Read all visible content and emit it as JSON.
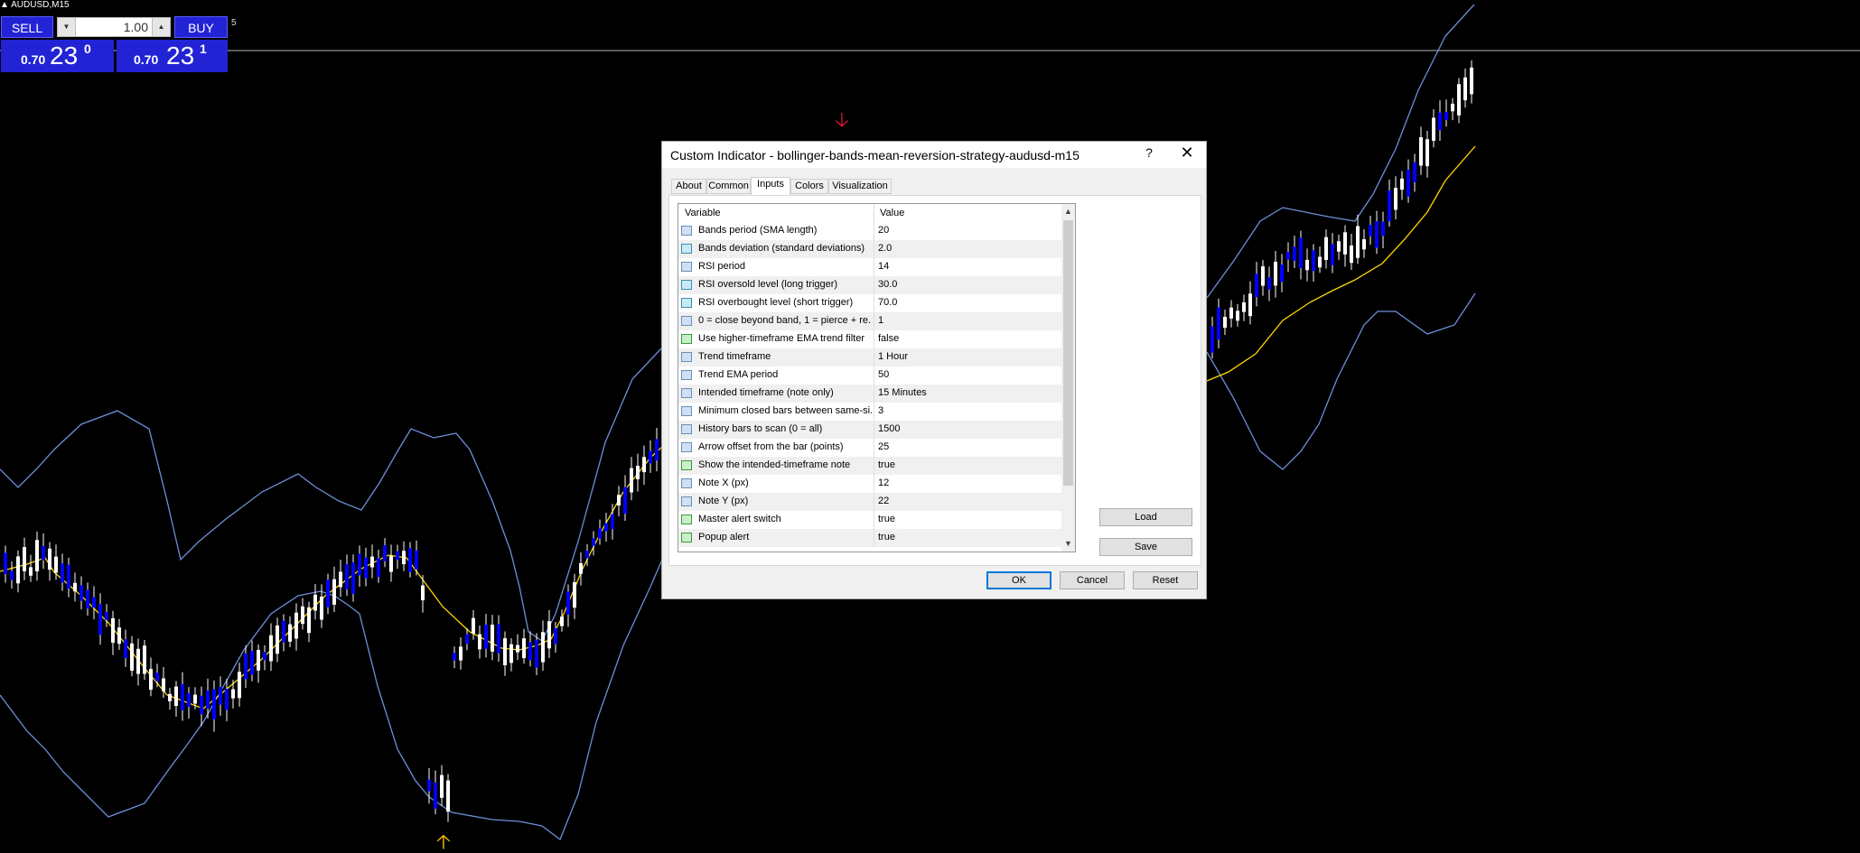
{
  "chart": {
    "symbol": "AUDUSD,M15",
    "spread": "5"
  },
  "trade_panel": {
    "sell_label": "SELL",
    "buy_label": "BUY",
    "lot_value": "1.00",
    "sell_price": {
      "prefix": "0.70",
      "big": "23",
      "sup": "0"
    },
    "buy_price": {
      "prefix": "0.70",
      "big": "23",
      "sup": "1"
    }
  },
  "colors": {
    "background": "#000000",
    "bull_candle": "#0000ff",
    "bear_candle": "#ffffff",
    "bollinger_band": "#6d8fd8",
    "middle_band": "#ffd700",
    "arrow_down": "#e0143c",
    "arrow_up": "#ffc400"
  },
  "markers": {
    "down_arrow": "🡣",
    "up_arrow": "🡡"
  },
  "dialog": {
    "title": "Custom Indicator - bollinger-bands-mean-reversion-strategy-audusd-m15",
    "help": "?",
    "close": "✕",
    "tabs": [
      "About",
      "Common",
      "Inputs",
      "Colors",
      "Visualization"
    ],
    "active_tab": "Inputs",
    "grid": {
      "col_variable": "Variable",
      "col_value": "Value",
      "rows": [
        {
          "icon": "int",
          "name": "Bands period (SMA length)",
          "value": "20"
        },
        {
          "icon": "dbl",
          "name": "Bands deviation (standard deviations)",
          "value": "2.0"
        },
        {
          "icon": "int",
          "name": "RSI period",
          "value": "14"
        },
        {
          "icon": "dbl",
          "name": "RSI oversold level (long trigger)",
          "value": "30.0"
        },
        {
          "icon": "dbl",
          "name": "RSI overbought level (short trigger)",
          "value": "70.0"
        },
        {
          "icon": "int",
          "name": "0 = close beyond band, 1 = pierce + re...",
          "value": "1"
        },
        {
          "icon": "bool",
          "name": "Use higher-timeframe EMA trend filter",
          "value": "false"
        },
        {
          "icon": "int",
          "name": "Trend timeframe",
          "value": "1 Hour"
        },
        {
          "icon": "int",
          "name": "Trend EMA period",
          "value": "50"
        },
        {
          "icon": "int",
          "name": "Intended timeframe (note only)",
          "value": "15 Minutes"
        },
        {
          "icon": "int",
          "name": "Minimum closed bars between same-si...",
          "value": "3"
        },
        {
          "icon": "int",
          "name": "History bars to scan (0 = all)",
          "value": "1500"
        },
        {
          "icon": "int",
          "name": "Arrow offset from the bar (points)",
          "value": "25"
        },
        {
          "icon": "bool",
          "name": "Show the intended-timeframe note",
          "value": "true"
        },
        {
          "icon": "int",
          "name": "Note X (px)",
          "value": "12"
        },
        {
          "icon": "int",
          "name": "Note Y (px)",
          "value": "22"
        },
        {
          "icon": "bool",
          "name": "Master alert switch",
          "value": "true"
        },
        {
          "icon": "bool",
          "name": "Popup alert",
          "value": "true"
        }
      ]
    },
    "buttons": {
      "load": "Load",
      "save": "Save",
      "ok": "OK",
      "cancel": "Cancel",
      "reset": "Reset"
    }
  }
}
